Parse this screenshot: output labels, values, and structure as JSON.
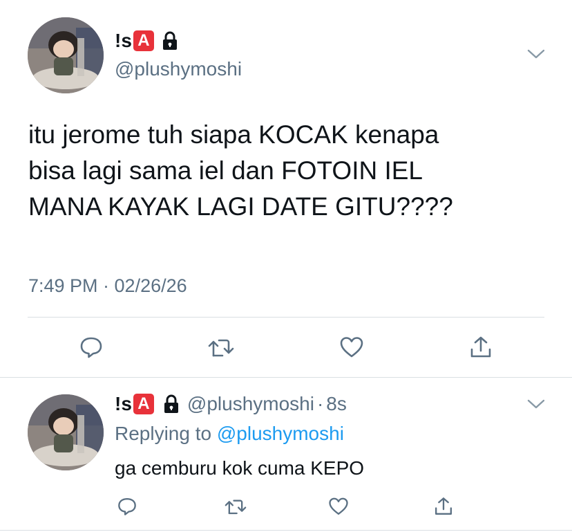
{
  "main_tweet": {
    "display_name_prefix": "!s",
    "badge_letter": "A",
    "handle": "@plushymoshi",
    "text_lines": [
      "itu jerome tuh siapa KOCAK kenapa",
      "bisa lagi sama iel dan FOTOIN IEL",
      "MANA KAYAK LAGI DATE GITU????"
    ],
    "timestamp": "7:49 PM · 02/26/26"
  },
  "reply_tweet": {
    "display_name_prefix": "!s",
    "badge_letter": "A",
    "handle": "@plushymoshi",
    "separator": "·",
    "age": "8s",
    "replying_to_label": "Replying to",
    "replying_to_handle": "@plushymoshi",
    "text": "ga cemburu kok cuma KEPO"
  },
  "icons": {
    "options": "chevron-down-icon",
    "reply": "comment-icon",
    "retweet": "retweet-icon",
    "like": "heart-icon",
    "share": "share-icon",
    "protected": "lock-icon"
  },
  "colors": {
    "text": "#0f1419",
    "secondary": "#5b7083",
    "link": "#1d9bf0",
    "badge": "#e8323a",
    "divider": "#d9dfe3"
  }
}
